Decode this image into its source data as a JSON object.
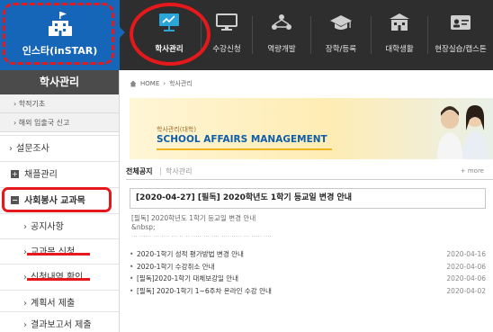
{
  "logo": {
    "text": "인스타(inSTAR)"
  },
  "nav": {
    "items": [
      {
        "label": "학사관리",
        "icon": "presentation-board-icon",
        "active": true
      },
      {
        "label": "수강신청",
        "icon": "monitor-icon",
        "active": false
      },
      {
        "label": "역량개발",
        "icon": "network-people-icon",
        "active": false
      },
      {
        "label": "장학/등록",
        "icon": "graduation-cap-icon",
        "active": false
      },
      {
        "label": "대학생활",
        "icon": "campus-building-icon",
        "active": false
      },
      {
        "label": "현장실습/캡스톤",
        "icon": "id-card-icon",
        "active": false
      }
    ]
  },
  "sidebar": {
    "title": "학사관리",
    "subs": [
      "학적기초",
      "해외 입출국 신고"
    ],
    "items": [
      {
        "label": "설문조사",
        "marker": "arrow"
      },
      {
        "label": "채플관리",
        "marker": "plus"
      },
      {
        "label": "사회봉사 교과목",
        "marker": "minus"
      },
      {
        "label": "공지사항",
        "marker": "arrow"
      },
      {
        "label": "교과목 신청",
        "marker": "arrow"
      },
      {
        "label": "신청내역 확인",
        "marker": "arrow"
      },
      {
        "label": "계획서 제출",
        "marker": "arrow"
      },
      {
        "label": "결과보고서 제출",
        "marker": "arrow"
      }
    ]
  },
  "breadcrumb": {
    "home": "HOME",
    "sep": "›",
    "current": "학사관리"
  },
  "banner": {
    "subtitle": "학사관리(대학)",
    "title": "SCHOOL AFFAIRS MANAGEMENT"
  },
  "tabs": {
    "active": "전체공지",
    "other": "학사관리",
    "more": "+ more"
  },
  "notice": {
    "title": "[2020-04-27] [필독] 2020학년도 1학기 등교일 변경 안내",
    "preview_lines": [
      "[필독] 2020학년도 1학기 등교일 변경 안내",
      "&nbsp;"
    ],
    "blur_line": "··· ······ ··· ···· ··· ·· ·· ····· ··· ···· ···· ····· ··· ····· ····"
  },
  "list": [
    {
      "title": "2020-1학기 성적 평가방법 변경 안내",
      "date": "2020-04-16"
    },
    {
      "title": "2020-1학기 수강취소 안내",
      "date": "2020-04-06"
    },
    {
      "title": "[필독]2020-1학기 대체보강일 안내",
      "date": "2020-04-06"
    },
    {
      "title": "[필독] 2020-1학기 1~6주차 온라인 수강 안내",
      "date": "2020-04-02"
    }
  ],
  "colors": {
    "accent_red": "#e5191c",
    "logo_blue": "#1565b8",
    "nav_dark": "#2e2e2e",
    "banner_blue": "#0e5da8"
  }
}
